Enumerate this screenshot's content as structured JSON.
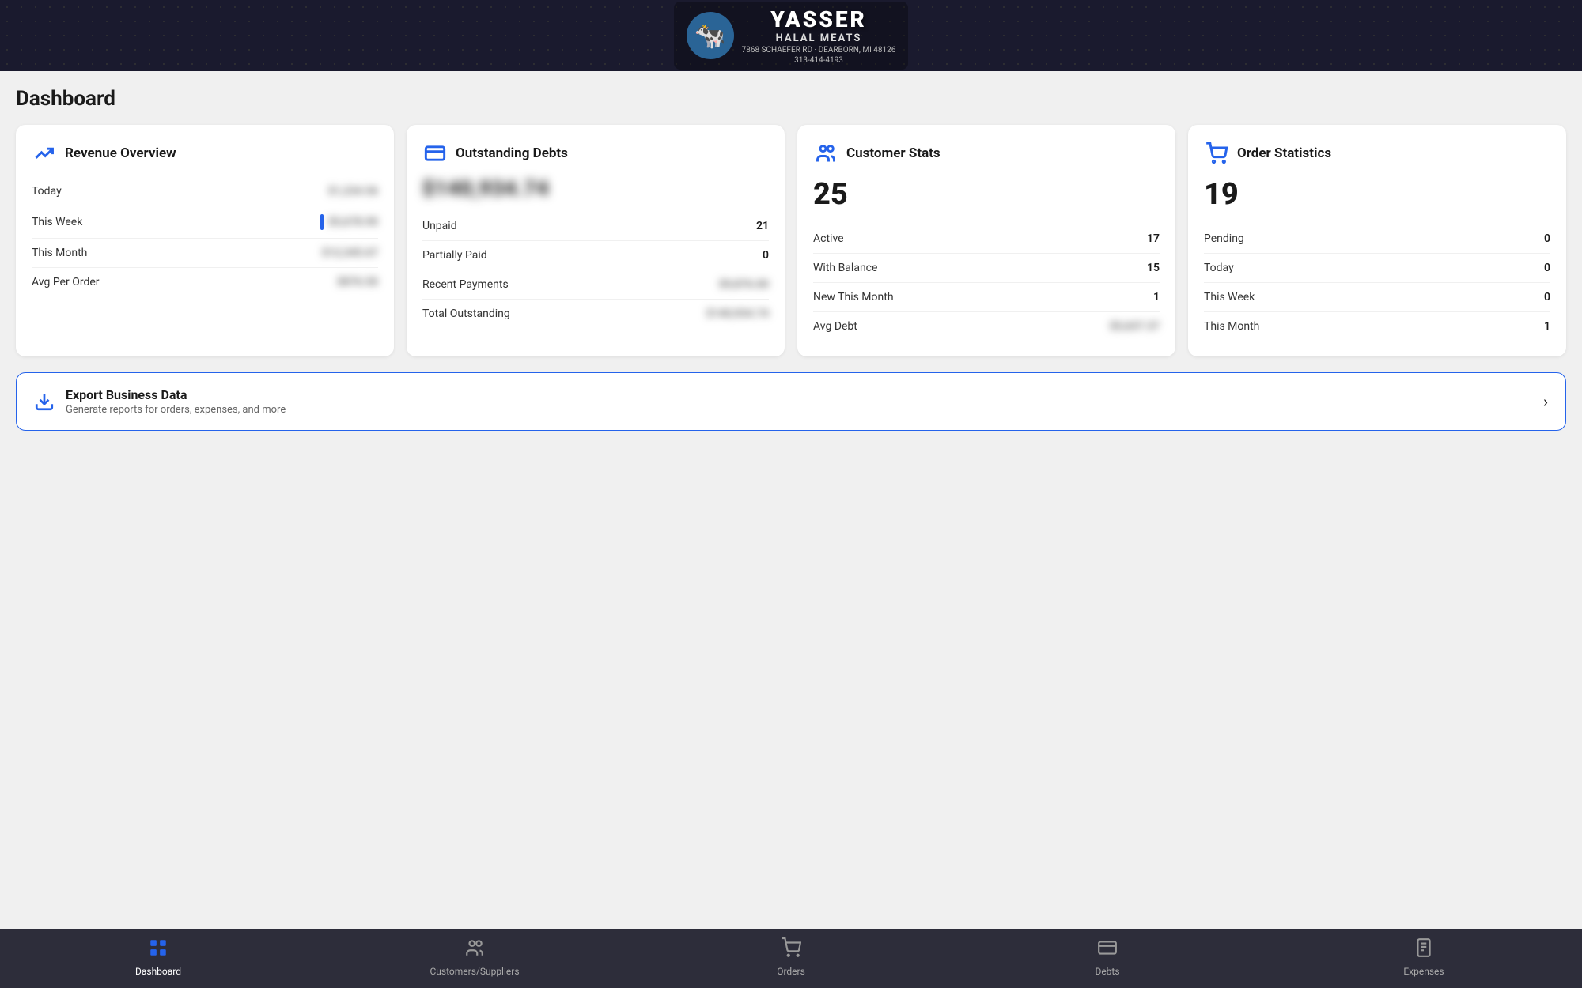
{
  "header": {
    "brand_name": "YASSER",
    "brand_sub": "HALAL MEATS",
    "brand_address": "7868 SCHAEFER RD · DEARBORN, MI 48126",
    "brand_phone": "313-414-4193",
    "logo_emoji": "🐄"
  },
  "page": {
    "title": "Dashboard"
  },
  "cards": {
    "revenue": {
      "title": "Revenue Overview",
      "rows": [
        {
          "label": "Today",
          "value": "••••••",
          "blurred": true
        },
        {
          "label": "This Week",
          "value": "••••••",
          "blurred": true
        },
        {
          "label": "This Month",
          "value": "••••••••",
          "blurred": true
        },
        {
          "label": "Avg Per Order",
          "value": "••••••••",
          "blurred": true
        }
      ]
    },
    "debts": {
      "title": "Outstanding Debts",
      "amount": "•••••••••",
      "amount_blurred": true,
      "rows": [
        {
          "label": "Unpaid",
          "value": "21",
          "blurred": false
        },
        {
          "label": "Partially Paid",
          "value": "0",
          "blurred": false
        },
        {
          "label": "Recent Payments",
          "value": "••••••••",
          "blurred": true
        },
        {
          "label": "Total Outstanding",
          "value": "••••••••••",
          "blurred": true
        }
      ]
    },
    "customers": {
      "title": "Customer Stats",
      "big_number": "25",
      "rows": [
        {
          "label": "Active",
          "value": "17",
          "blurred": false
        },
        {
          "label": "With Balance",
          "value": "15",
          "blurred": false
        },
        {
          "label": "New This Month",
          "value": "1",
          "blurred": false
        },
        {
          "label": "Avg Debt",
          "value": "••••••••",
          "blurred": true
        }
      ]
    },
    "orders": {
      "title": "Order Statistics",
      "big_number": "19",
      "rows": [
        {
          "label": "Pending",
          "value": "0",
          "blurred": false
        },
        {
          "label": "Today",
          "value": "0",
          "blurred": false
        },
        {
          "label": "This Week",
          "value": "0",
          "blurred": false
        },
        {
          "label": "This Month",
          "value": "1",
          "blurred": false
        }
      ]
    }
  },
  "export": {
    "title": "Export Business Data",
    "subtitle": "Generate reports for orders, expenses, and more"
  },
  "nav": {
    "items": [
      {
        "label": "Dashboard",
        "active": true
      },
      {
        "label": "Customers/Suppliers",
        "active": false
      },
      {
        "label": "Orders",
        "active": false
      },
      {
        "label": "Debts",
        "active": false
      },
      {
        "label": "Expenses",
        "active": false
      }
    ]
  }
}
